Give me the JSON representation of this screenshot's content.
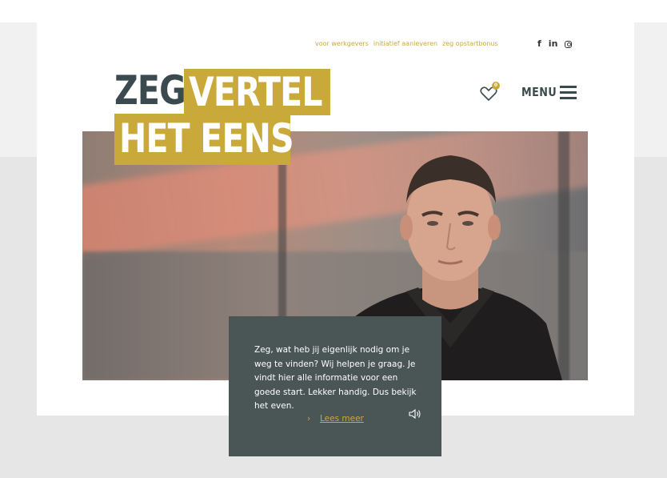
{
  "util_nav": {
    "links": [
      "voor werkgevers",
      "initiatief aanleveren",
      "zeg opstartbonus"
    ]
  },
  "social": {
    "facebook": "f",
    "linkedin": "in",
    "icons": [
      "facebook-icon",
      "linkedin-icon",
      "instagram-icon"
    ]
  },
  "logo": {
    "line1_a": "ZEG",
    "line1_b": "VERTEL",
    "line2": "HET EENS"
  },
  "header": {
    "favorites_count": "0",
    "menu_label": "MENU"
  },
  "panel": {
    "text": "Zeg, wat heb jij eigenlijk nodig om je weg te vinden? Wij helpen je graag. Je vindt hier alle informatie voor een goede start. Lekker handig. Dus bekijk het even.",
    "link_label": "Lees meer",
    "chevron": "›"
  },
  "colors": {
    "accent": "#c9a93a",
    "dark": "#3a4a4f",
    "panel": "#4a5556"
  }
}
